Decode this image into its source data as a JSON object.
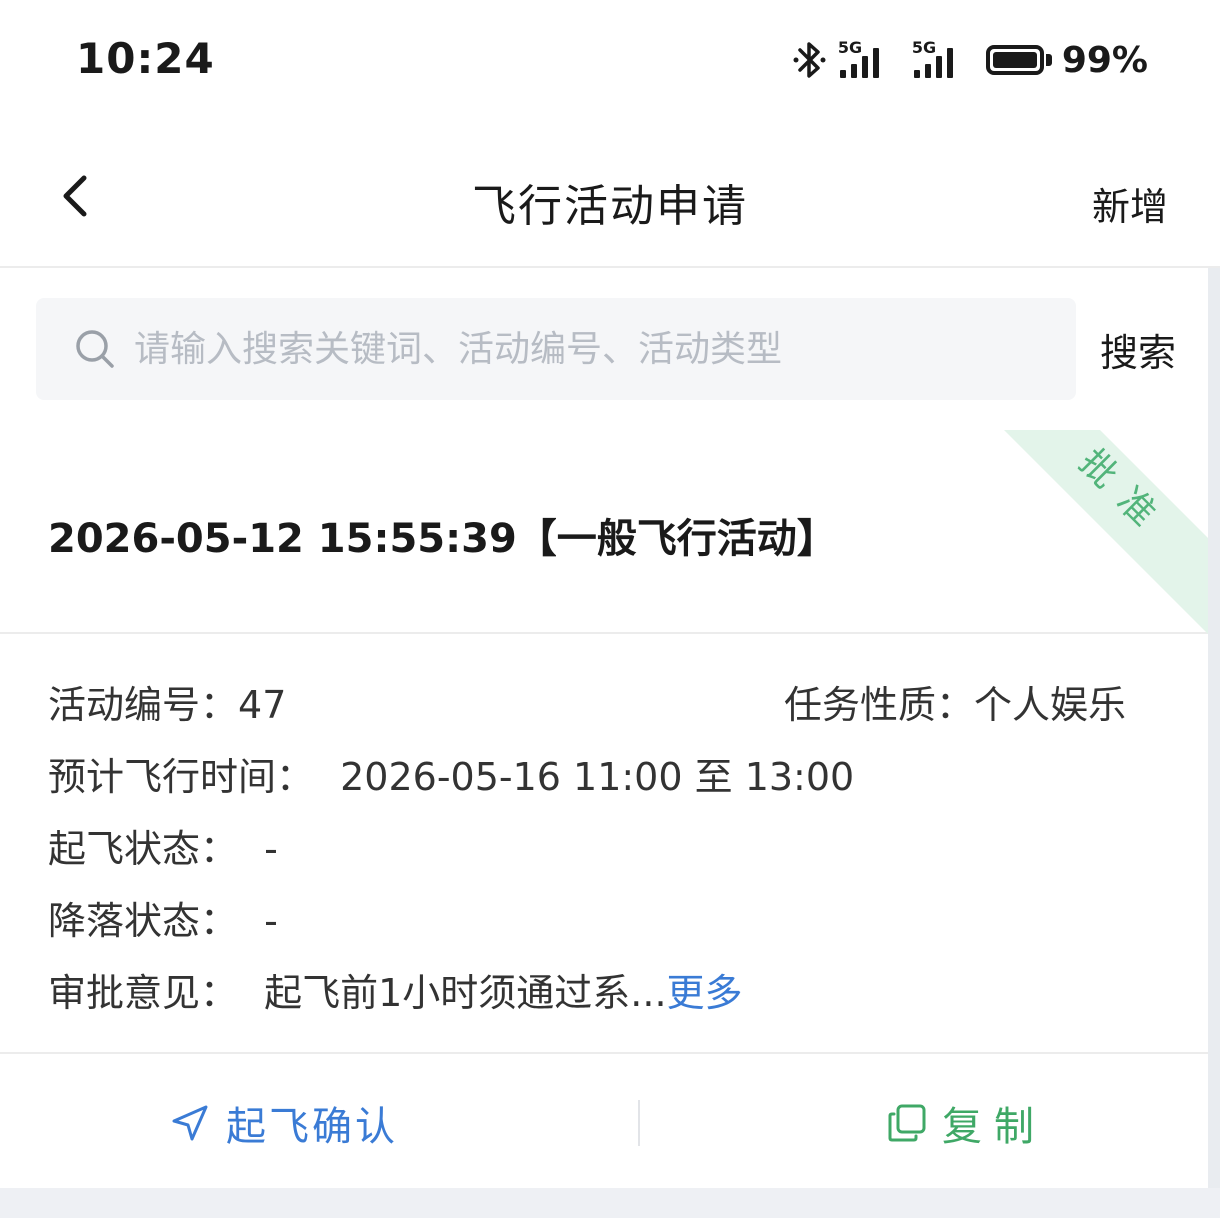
{
  "status_bar": {
    "time": "10:24",
    "network_1": "5G",
    "network_2": "5G",
    "battery": "99%",
    "icons": [
      "bluetooth-icon",
      "signal-icon",
      "signal-icon",
      "battery-icon"
    ]
  },
  "nav": {
    "title": "飞行活动申请",
    "action": "新增",
    "back_icon": "chevron-left-icon"
  },
  "search": {
    "placeholder": "请输入搜索关键词、活动编号、活动类型",
    "value": "",
    "button": "搜索"
  },
  "card": {
    "title": "2026-05-12 15:55:39【一般飞行活动】",
    "badge": "批准",
    "badge_color": "#52b47a",
    "details": {
      "activity_no_label": "活动编号：",
      "activity_no_value": "47",
      "task_type_label": "任务性质：",
      "task_type_value": "个人娱乐",
      "planned_time_label": "预计飞行时间：",
      "planned_time_value": "2026-05-16 11:00 至 13:00",
      "takeoff_label": "起飞状态：",
      "takeoff_value": "-",
      "landing_label": "降落状态：",
      "landing_value": "-",
      "opinion_label": "审批意见：",
      "opinion_value": "起飞前1小时须通过系...",
      "opinion_more": "更多"
    },
    "actions": {
      "confirm_takeoff": "起飞确认",
      "copy": "复制",
      "confirm_color": "#3a7bd5",
      "copy_color": "#3fa866"
    }
  }
}
